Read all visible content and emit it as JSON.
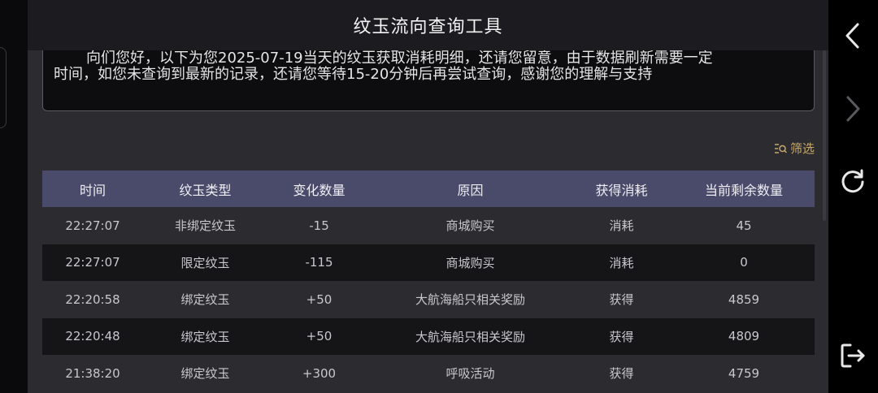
{
  "window": {
    "title": "纹玉流向查询工具"
  },
  "notice": {
    "line1": "向们您好，以下为您2025-07-19当天的纹玉获取消耗明细，还请您留意，由于数据刷新需要一定",
    "line2": "时间，如您未查询到最新的记录，还请您等待15-20分钟后再尝试查询，感谢您的理解与支持"
  },
  "filter": {
    "label": "筛选",
    "icon": "filter-icon"
  },
  "table": {
    "headers": [
      "时间",
      "纹玉类型",
      "变化数量",
      "原因",
      "获得消耗",
      "当前剩余数量"
    ],
    "rows": [
      [
        "22:27:07",
        "非绑定纹玉",
        "-15",
        "商城购买",
        "消耗",
        "45"
      ],
      [
        "22:27:07",
        "限定纹玉",
        "-115",
        "商城购买",
        "消耗",
        "0"
      ],
      [
        "22:20:58",
        "绑定纹玉",
        "+50",
        "大航海船只相关奖励",
        "获得",
        "4859"
      ],
      [
        "22:20:48",
        "绑定纹玉",
        "+50",
        "大航海船只相关奖励",
        "获得",
        "4809"
      ],
      [
        "21:38:20",
        "绑定纹玉",
        "+300",
        "呼吸活动",
        "获得",
        "4759"
      ]
    ]
  },
  "nav": {
    "back_icon": "chevron-left-icon",
    "forward_icon": "chevron-right-icon",
    "refresh_icon": "refresh-icon",
    "exit_icon": "exit-icon"
  },
  "colors": {
    "header_bg": "#4a4b6a",
    "row_light": "#2b2b30",
    "row_dark": "#151518",
    "accent": "#c9a96b"
  }
}
